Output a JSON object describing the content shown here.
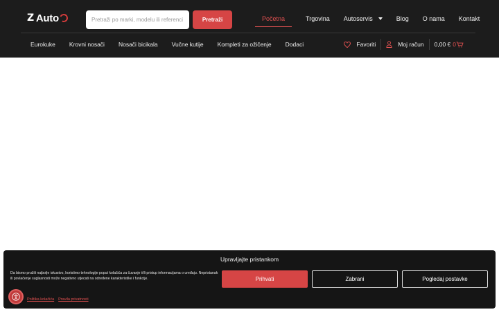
{
  "header": {
    "logo_text": "Auto",
    "search": {
      "placeholder": "Pretraži po marki, modelu ili referenci i",
      "button_label": "Pretraži"
    },
    "top_nav": [
      {
        "label": "Početna",
        "active": true
      },
      {
        "label": "Trgovina"
      },
      {
        "label": "Autoservis",
        "has_dropdown": true
      },
      {
        "label": "Blog"
      },
      {
        "label": "O nama"
      },
      {
        "label": "Kontakt"
      }
    ],
    "categories": [
      "Eurokuke",
      "Krovni nosači",
      "Nosači bicikala",
      "Vučne kutije",
      "Kompleti za ožičenje",
      "Dodaci"
    ],
    "tools": {
      "favorites_label": "Favoriti",
      "account_label": "Moj račun",
      "cart_total": "0,00 €",
      "cart_count": "0"
    }
  },
  "cookie_banner": {
    "title": "Upravljajte pristankom",
    "text": "Da bismo pružili najbolje iskustvo, koristimo tehnologije poput kolačića za čuvanje i/ili pristup informacijama o uređaju. Nepristanak ili povlačenje suglasnosti može negativno utjecati na određene karakteristike i funkcije.",
    "accept_label": "Prihvati",
    "deny_label": "Zabrani",
    "prefs_label": "Pogledaj postavke",
    "links": [
      "Politika kolačića",
      "Pravila privatnosti"
    ]
  },
  "colors": {
    "header_bg": "#1c1c1c",
    "accent": "#d64545",
    "banner_bg": "#151515"
  },
  "icons": [
    "heart-icon",
    "user-icon",
    "cart-icon",
    "accessibility-icon",
    "chevron-down-icon"
  ]
}
